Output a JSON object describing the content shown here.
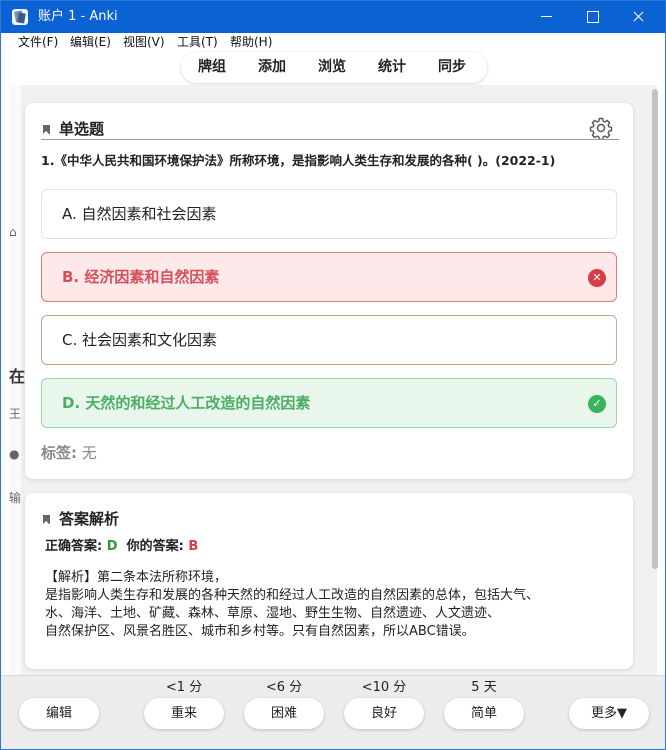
{
  "window": {
    "title": "账户 1 - Anki"
  },
  "menu": [
    "文件(F)",
    "编辑(E)",
    "视图(V)",
    "工具(T)",
    "帮助(H)"
  ],
  "toolbar": [
    "牌组",
    "添加",
    "浏览",
    "统计",
    "同步"
  ],
  "question_card": {
    "title": "单选题",
    "question": "1.《中华人民共和国环境保护法》所称环境，是指影响人类生存和发展的各种( )。(2022-1)",
    "options": [
      {
        "label": "A. 自然因素和社会因素",
        "state": "neutral"
      },
      {
        "label": "B. 经济因素和自然因素",
        "state": "wrong"
      },
      {
        "label": "C. 社会因素和文化因素",
        "state": "neutral"
      },
      {
        "label": "D. 天然的和经过人工改造的自然因素",
        "state": "correct"
      }
    ],
    "tags_label": "标签:",
    "tags_value": "无"
  },
  "answer_card": {
    "title": "答案解析",
    "correct_label": "正确答案:",
    "correct_value": "D",
    "yours_label": "你的答案:",
    "yours_value": "B",
    "explanation": [
      "【解析】第二条本法所称环境，",
      "是指影响人类生存和发展的各种天然的和经过人工改造的自然因素的总体，包括大气、",
      "水、海洋、土地、矿藏、森林、草原、湿地、野生生物、自然遗迹、人文遗迹、",
      "自然保护区、风景名胜区、城市和乡村等。只有自然因素，所以ABC错误。"
    ]
  },
  "bottom_bar": {
    "edit_label": "编辑",
    "intervals": [
      "<1 分",
      "<6 分",
      "<10 分",
      "5 天"
    ],
    "answer_buttons": [
      "重来",
      "困难",
      "良好",
      "简单"
    ],
    "more_label": "更多▼"
  },
  "colors": {
    "titlebar": "#0b63d3",
    "wrong_bg": "#fde9e9",
    "wrong_text": "#d6505a",
    "correct_bg": "#e8f6ec",
    "correct_text": "#4cae65"
  }
}
